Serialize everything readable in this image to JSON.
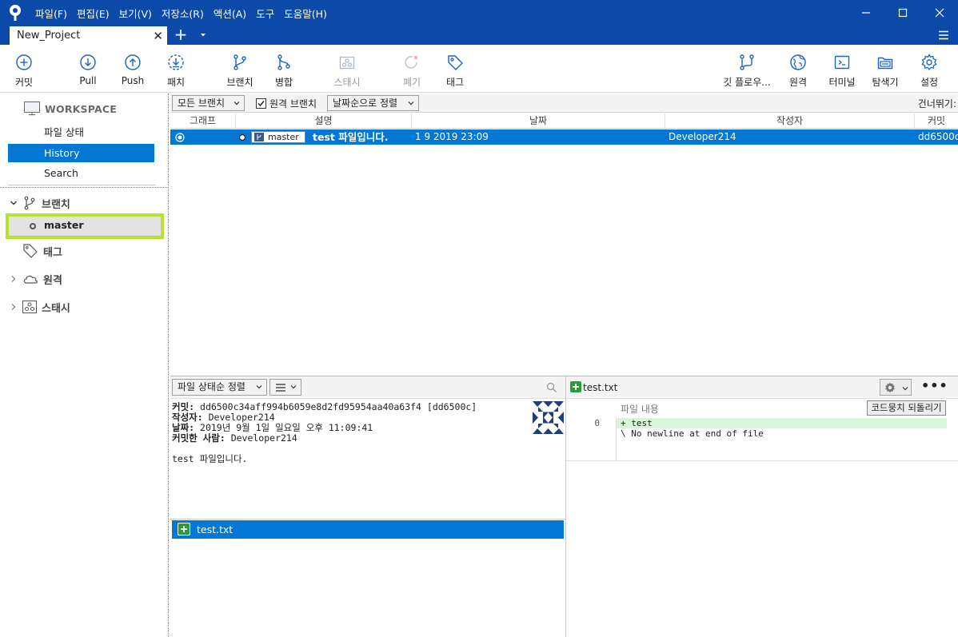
{
  "window": {
    "menus": [
      "파일(F)",
      "편집(E)",
      "보기(V)",
      "저장소(R)",
      "액션(A)",
      "도구",
      "도움말(H)"
    ],
    "tab": {
      "title": "New_Project",
      "close": "✕"
    },
    "new_tab": "+",
    "controls": {
      "minimize": "—",
      "maximize": "☐",
      "close": "✕"
    }
  },
  "toolbar": {
    "commit": "커밋",
    "pull": "Pull",
    "push": "Push",
    "patch": "패치",
    "branch": "브랜치",
    "merge": "병합",
    "stash": "스태시",
    "discard": "폐기",
    "tag": "태그",
    "git_flow": "깃 플로우...",
    "remote": "원격",
    "terminal": "터미널",
    "explorer": "탐색기",
    "settings": "설정"
  },
  "sidebar": {
    "workspace": "WORKSPACE",
    "items": [
      {
        "label": "파일 상태"
      },
      {
        "label": "History"
      },
      {
        "label": "Search"
      }
    ],
    "branches": "브랜치",
    "current_branch": "master",
    "tags": "태그",
    "remotes": "원격",
    "stashes": "스태시"
  },
  "history": {
    "branch_filter": "모든 브랜치",
    "remote_branches_label": "원격 브랜치",
    "remote_branches_checked": true,
    "sort": "날짜순으로 정렬",
    "skip_label": "건너뛰기:",
    "columns": {
      "graph": "그래프",
      "desc": "설명",
      "date": "날짜",
      "author": "작성자",
      "commit": "커밋"
    },
    "rows": [
      {
        "branch_tag": "master",
        "message": "test 파일입니다.",
        "date": "1 9 2019 23:09",
        "author": "Developer214",
        "hash": "dd6500c"
      }
    ]
  },
  "file_status": {
    "sort": "파일 상태순 정렬",
    "details": {
      "commit_label": "커밋:",
      "commit_value": "dd6500c34aff994b6059e8d2fd95954aa40a63f4 [dd6500c]",
      "author_label": "작성자:",
      "author_value": "Developer214",
      "date_label": "날짜:",
      "date_value": "2019년 9월 1일 일요일 오후 11:09:41",
      "committer_label": "커밋한 사람:",
      "committer_value": "Developer214",
      "message": "test 파일입니다."
    },
    "files": [
      {
        "name": "test.txt"
      }
    ]
  },
  "diff": {
    "file": "test.txt",
    "hunk_label": "파일 내용",
    "revert": "코드뭉치 되돌리기",
    "more": "•••",
    "lines": [
      {
        "num": "0",
        "text": "+ test"
      },
      {
        "num": "",
        "text": "\\  No newline at end of file"
      }
    ]
  }
}
